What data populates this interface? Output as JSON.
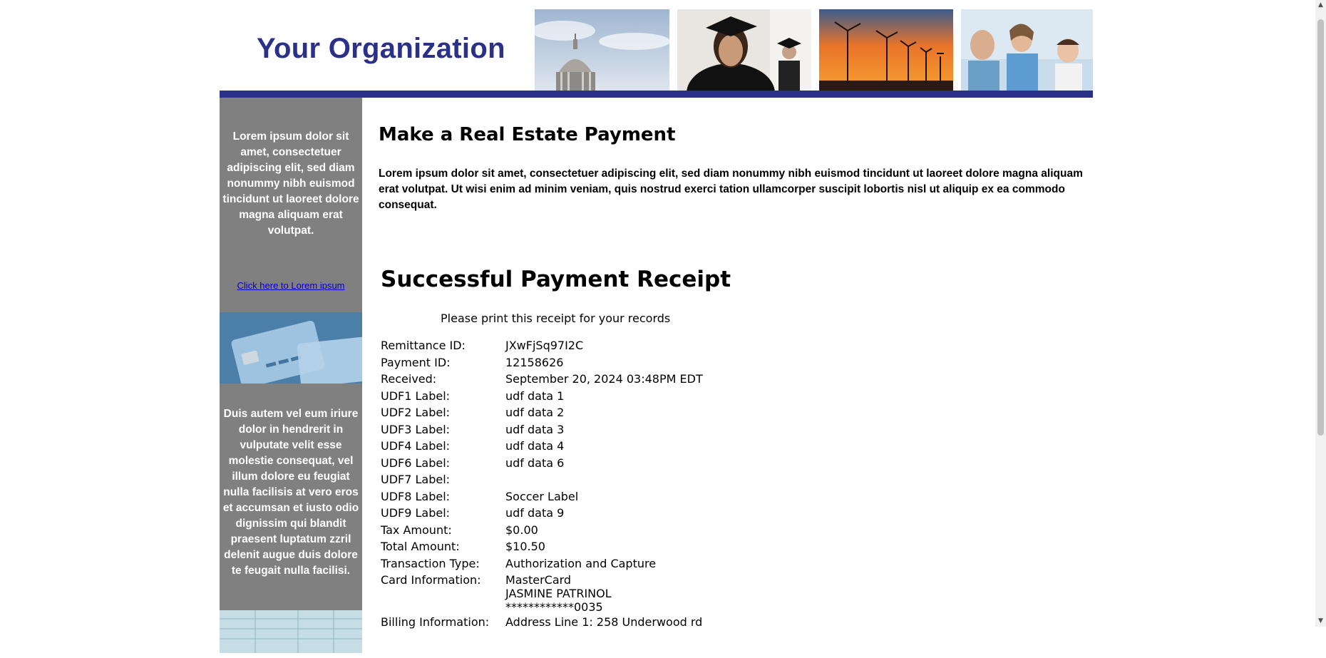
{
  "header": {
    "org_title": "Your Organization",
    "brand_color": "#2b3088",
    "photos": [
      "capitol-dome-photo",
      "graduate-photo",
      "wind-turbines-photo",
      "family-doctor-photo"
    ]
  },
  "sidebar": {
    "background": "#808080",
    "text1": "Lorem ipsum dolor sit amet, consectetuer adipiscing elit, sed diam nonummy nibh euismod tincidunt ut laoreet dolore magna aliquam erat volutpat.",
    "link": "Click here to Lorem ipsum",
    "text2": "Duis autem vel eum iriure dolor in hendrerit in vulputate velit esse molestie consequat, vel illum dolore eu feugiat nulla facilisis at vero eros et accumsan et iusto odio dignissim qui blandit praesent luptatum zzril delenit augue duis dolore te feugait nulla facilisi."
  },
  "main": {
    "page_title": "Make a Real Estate Payment",
    "intro": "Lorem ipsum dolor sit amet, consectetuer adipiscing elit, sed diam nonummy nibh euismod tincidunt ut laoreet dolore magna aliquam erat volutpat. Ut wisi enim ad minim veniam, quis nostrud exerci tation ullamcorper suscipit lobortis nisl ut aliquip ex ea commodo consequat."
  },
  "receipt": {
    "title": "Successful Payment Receipt",
    "print_note": "Please print this receipt for your records",
    "rows": [
      {
        "label": "Remittance ID:",
        "value": "JXwFjSq97I2C"
      },
      {
        "label": "Payment ID:",
        "value": "12158626"
      },
      {
        "label": "Received:",
        "value": "September 20, 2024 03:48PM EDT"
      },
      {
        "label": "UDF1 Label:",
        "value": "udf data 1"
      },
      {
        "label": "UDF2 Label:",
        "value": "udf data 2"
      },
      {
        "label": "UDF3 Label:",
        "value": "udf data 3"
      },
      {
        "label": "UDF4 Label:",
        "value": "udf data 4"
      },
      {
        "label": "UDF6 Label:",
        "value": "udf data 6"
      },
      {
        "label": "UDF7 Label:",
        "value": ""
      },
      {
        "label": "UDF8 Label:",
        "value": "Soccer Label"
      },
      {
        "label": "UDF9 Label:",
        "value": "udf data 9"
      },
      {
        "label": "Tax Amount:",
        "value": "$0.00"
      },
      {
        "label": "Total Amount:",
        "value": "$10.50"
      },
      {
        "label": "Transaction Type:",
        "value": "Authorization and Capture"
      }
    ],
    "card": {
      "label": "Card Information:",
      "type": "MasterCard",
      "name": "JASMINE PATRINOL",
      "number": "************0035"
    },
    "billing": {
      "label": "Billing Information:",
      "line1": "Address Line 1: 258 Underwood rd"
    }
  }
}
